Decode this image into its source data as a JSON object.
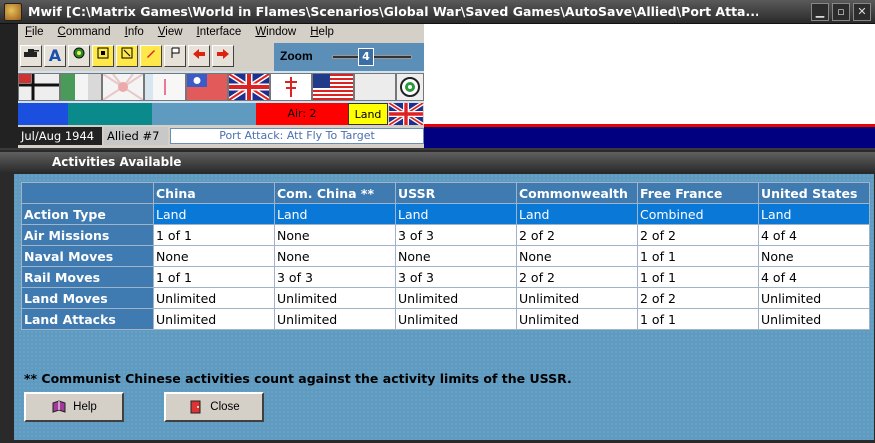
{
  "window": {
    "title": "Mwif [C:\\Matrix Games\\World in Flames\\Scenarios\\Global War\\Saved Games\\AutoSave\\Allied\\Port Atta...",
    "min_glyph": "▁",
    "max_glyph": "▫",
    "close_glyph": "✕"
  },
  "menu": [
    "File",
    "Command",
    "Info",
    "View",
    "Interface",
    "Window",
    "Help"
  ],
  "toolbar": {
    "zoom_label": "Zoom",
    "zoom_value": "4",
    "buttons": [
      "A"
    ]
  },
  "unit_strip": {
    "air_label": "Air: 2",
    "land_label": "Land"
  },
  "status": {
    "date": "Jul/Aug 1944",
    "side": "Allied #7",
    "message": "Port Attack: Att Fly To Target"
  },
  "dialog": {
    "title": "Activities Available",
    "columns": [
      "China",
      "Com. China **",
      "USSR",
      "Commonwealth",
      "Free France",
      "United States"
    ],
    "rows": [
      {
        "label": "Action Type",
        "values": [
          "Land",
          "Land",
          "Land",
          "Land",
          "Combined",
          "Land"
        ]
      },
      {
        "label": "Air Missions",
        "values": [
          "1 of 1",
          "None",
          "3 of 3",
          "2 of 2",
          "2 of 2",
          "4 of 4"
        ]
      },
      {
        "label": "Naval Moves",
        "values": [
          "None",
          "None",
          "None",
          "None",
          "1 of 1",
          "None"
        ]
      },
      {
        "label": "Rail Moves",
        "values": [
          "1 of 1",
          "3 of 3",
          "3 of 3",
          "2 of 2",
          "1 of 1",
          "4 of 4"
        ]
      },
      {
        "label": "Land Moves",
        "values": [
          "Unlimited",
          "Unlimited",
          "Unlimited",
          "Unlimited",
          "2 of 2",
          "Unlimited"
        ]
      },
      {
        "label": "Land Attacks",
        "values": [
          "Unlimited",
          "Unlimited",
          "Unlimited",
          "Unlimited",
          "1 of 1",
          "Unlimited"
        ]
      }
    ],
    "footnote": "** Communist Chinese activities count against the activity limits of the USSR.",
    "help_label": "Help",
    "close_label": "Close"
  }
}
